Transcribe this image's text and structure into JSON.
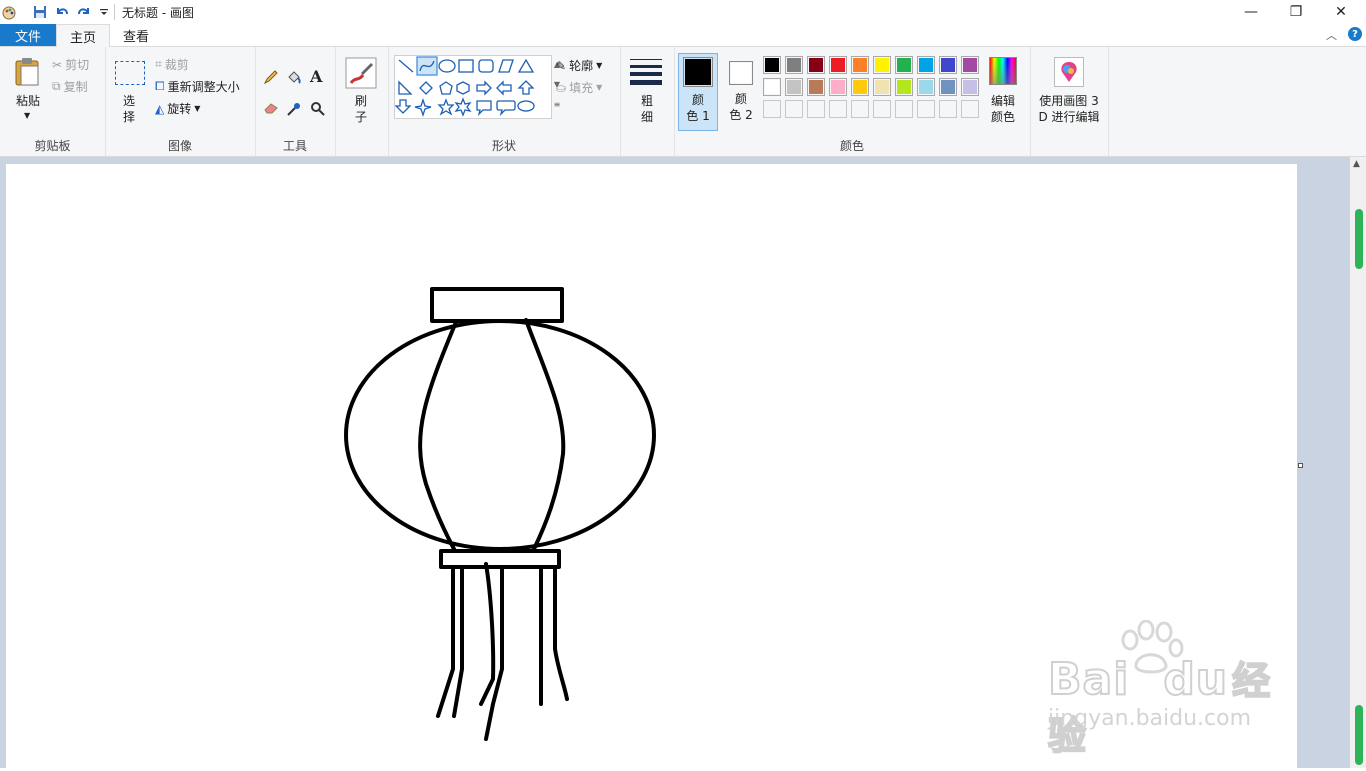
{
  "window": {
    "title": "无标题 - 画图",
    "minimize_glyph": "—",
    "maximize_glyph": "❐",
    "close_glyph": "✕"
  },
  "tabs": {
    "file": "文件",
    "home": "主页",
    "view": "查看"
  },
  "ribbon": {
    "clipboard": {
      "label": "剪贴板",
      "paste_l1": "粘贴",
      "cut": "剪切",
      "copy": "复制"
    },
    "image": {
      "label": "图像",
      "select_l1": "选",
      "select_l2": "择",
      "crop": "裁剪",
      "resize": "重新调整大小",
      "rotate": "旋转"
    },
    "tools": {
      "label": "工具"
    },
    "brushes": {
      "l1": "刷",
      "l2": "子"
    },
    "shapes": {
      "label": "形状",
      "outline": "轮廓",
      "fill": "填充"
    },
    "size": {
      "l1": "粗",
      "l2": "细"
    },
    "colors": {
      "label": "颜色",
      "color1_l1": "颜",
      "color1_l2": "色 1",
      "color2_l1": "颜",
      "color2_l2": "色 2",
      "edit_l1": "编辑",
      "edit_l2": "颜色",
      "color1": "#000000",
      "color2": "#ffffff",
      "palette": [
        "#000000",
        "#7f7f7f",
        "#880015",
        "#ed1c24",
        "#ff7f27",
        "#fff200",
        "#22b14c",
        "#00a2e8",
        "#3f48cc",
        "#a349a4",
        "#ffffff",
        "#c3c3c3",
        "#b97a57",
        "#ffaec9",
        "#ffc90e",
        "#efe4b0",
        "#b5e61d",
        "#99d9ea",
        "#7092be",
        "#c8bfe7",
        "",
        "",
        "",
        "",
        "",
        "",
        "",
        "",
        "",
        ""
      ]
    },
    "paint3d": {
      "l1": "使用画图 3",
      "l2": "D 进行编辑"
    }
  },
  "watermark": {
    "brand": "Bai",
    "brand2": "du",
    "suffix": "经验",
    "url": "jingyan.baidu.com"
  },
  "theme": {
    "accent": "#1979ca",
    "canvas_bg": "#c9d3e2"
  }
}
